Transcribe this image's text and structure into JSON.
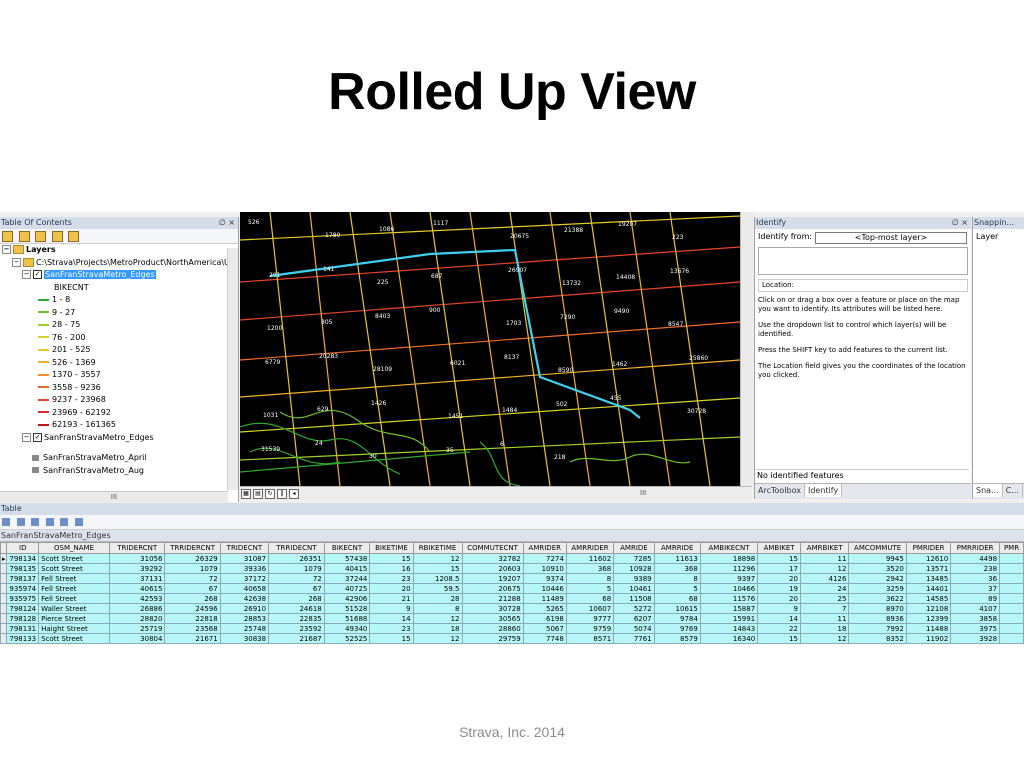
{
  "slide": {
    "title": "Rolled Up View",
    "footer": "Strava, Inc. 2014"
  },
  "toc": {
    "title": "Table Of Contents",
    "pin": "∅ ×",
    "root": "Layers",
    "path": "C:\\Strava\\Projects\\MetroProduct\\NorthAmerica\\USA\\",
    "layer": "SanFranStravaMetro_Edges",
    "field": "BIKECNT",
    "legend": [
      {
        "label": "1 - 8",
        "color": "#2fa82f"
      },
      {
        "label": "9 - 27",
        "color": "#6bbf2a"
      },
      {
        "label": "28 - 75",
        "color": "#a3cf2a"
      },
      {
        "label": "76 - 200",
        "color": "#d4d42a"
      },
      {
        "label": "201 - 525",
        "color": "#e6c82a"
      },
      {
        "label": "526 - 1369",
        "color": "#f0b02a"
      },
      {
        "label": "1370 - 3557",
        "color": "#f0902a"
      },
      {
        "label": "3558 - 9236",
        "color": "#ee6a2a"
      },
      {
        "label": "9237 - 23968",
        "color": "#e8452a"
      },
      {
        "label": "23969 - 62192",
        "color": "#dd2a2a"
      },
      {
        "label": "62193 - 161365",
        "color": "#c81414"
      }
    ],
    "layer2": "SanFranStravaMetro_Edges",
    "layer3": "SanFranStravaMetro_April",
    "layer4": "SanFranStravaMetro_Aug",
    "hscroll_mark": "III"
  },
  "map": {
    "labels": [
      "526",
      "1780",
      "1086",
      "1117",
      "20675",
      "21388",
      "19207",
      "223",
      "201",
      "141",
      "225",
      "687",
      "26907",
      "13732",
      "14408",
      "13676",
      "1200",
      "805",
      "8403",
      "900",
      "1703",
      "7290",
      "9490",
      "8547",
      "6779",
      "20283",
      "28109",
      "6021",
      "8137",
      "8590",
      "1462",
      "25860",
      "1031",
      "629",
      "1426",
      "1451",
      "1484",
      "502",
      "455",
      "30728",
      "31539",
      "24",
      "30",
      "35",
      "6",
      "218"
    ],
    "hscroll_mark": "III"
  },
  "identify": {
    "title": "Identify",
    "pin": "∅ ×",
    "from_label": "Identify from:",
    "from_value": "<Top-most layer>",
    "location_label": "Location:",
    "help": [
      "Click on or drag a box over a feature or place on the map you want to identify. Its attributes will be listed here.",
      "Use the dropdown list to control which layer(s) will be identified.",
      "Press the SHIFT key to add features to the current list.",
      "The Location field gives you the coordinates of the location you clicked."
    ],
    "status": "No identified features",
    "tab1": "ArcToolbox",
    "tab2": "Identify"
  },
  "snapping": {
    "title": "Snappin...",
    "label": "Layer",
    "tab1": "Sna...",
    "tab2": "C..."
  },
  "table": {
    "title": "Table",
    "layer": "SanFranStravaMetro_Edges",
    "columns": [
      "ID",
      "OSM_NAME",
      "TRIDERCNT",
      "TRRIDERCNT",
      "TRIDECNT",
      "TRRIDECNT",
      "BIKECNT",
      "BIKETIME",
      "RBIKETIME",
      "COMMUTECNT",
      "AMRIDER",
      "AMRRIDER",
      "AMRIDE",
      "AMRRIDE",
      "AMBIKECNT",
      "AMBIKET",
      "AMRBIKET",
      "AMCOMMUTE",
      "PMRIDER",
      "PMRRIDER",
      "PMR"
    ],
    "rows": [
      [
        "798134",
        "Scott Street",
        "31056",
        "26329",
        "31087",
        "26351",
        "57438",
        "15",
        "12",
        "32782",
        "7274",
        "11602",
        "7285",
        "11613",
        "18898",
        "15",
        "11",
        "9945",
        "12610",
        "4498",
        ""
      ],
      [
        "798135",
        "Scott Street",
        "39292",
        "1079",
        "39336",
        "1079",
        "40415",
        "16",
        "15",
        "20603",
        "10910",
        "368",
        "10928",
        "368",
        "11296",
        "17",
        "12",
        "3520",
        "13571",
        "238",
        ""
      ],
      [
        "798137",
        "Fell Street",
        "37131",
        "72",
        "37172",
        "72",
        "37244",
        "23",
        "1208.5",
        "19207",
        "9374",
        "8",
        "9389",
        "8",
        "9397",
        "20",
        "4126",
        "2942",
        "13485",
        "36",
        ""
      ],
      [
        "935974",
        "Fell Street",
        "40615",
        "67",
        "40658",
        "67",
        "40725",
        "20",
        "59.5",
        "20675",
        "10446",
        "5",
        "10461",
        "5",
        "10466",
        "19",
        "24",
        "3259",
        "14401",
        "37",
        ""
      ],
      [
        "935975",
        "Fell Street",
        "42593",
        "268",
        "42638",
        "268",
        "42906",
        "21",
        "28",
        "21288",
        "11489",
        "68",
        "11508",
        "68",
        "11576",
        "20",
        "25",
        "3622",
        "14585",
        "89",
        ""
      ],
      [
        "798124",
        "Waller Street",
        "26886",
        "24596",
        "26910",
        "24618",
        "51528",
        "9",
        "8",
        "30728",
        "5265",
        "10607",
        "5272",
        "10615",
        "15887",
        "9",
        "7",
        "8970",
        "12108",
        "4107",
        ""
      ],
      [
        "798128",
        "Pierce Street",
        "28820",
        "22818",
        "28853",
        "22835",
        "51688",
        "14",
        "12",
        "30565",
        "6198",
        "9777",
        "6207",
        "9784",
        "15991",
        "14",
        "11",
        "8936",
        "12399",
        "3858",
        ""
      ],
      [
        "798131",
        "Haight Street",
        "25719",
        "23568",
        "25748",
        "23592",
        "49340",
        "23",
        "18",
        "28860",
        "5067",
        "9759",
        "5074",
        "9769",
        "14843",
        "22",
        "18",
        "7992",
        "11488",
        "3975",
        ""
      ],
      [
        "798133",
        "Scott Street",
        "30804",
        "21671",
        "30838",
        "21687",
        "52525",
        "15",
        "12",
        "29759",
        "7748",
        "8571",
        "7761",
        "8579",
        "16340",
        "15",
        "12",
        "8352",
        "11902",
        "3928",
        ""
      ]
    ]
  }
}
